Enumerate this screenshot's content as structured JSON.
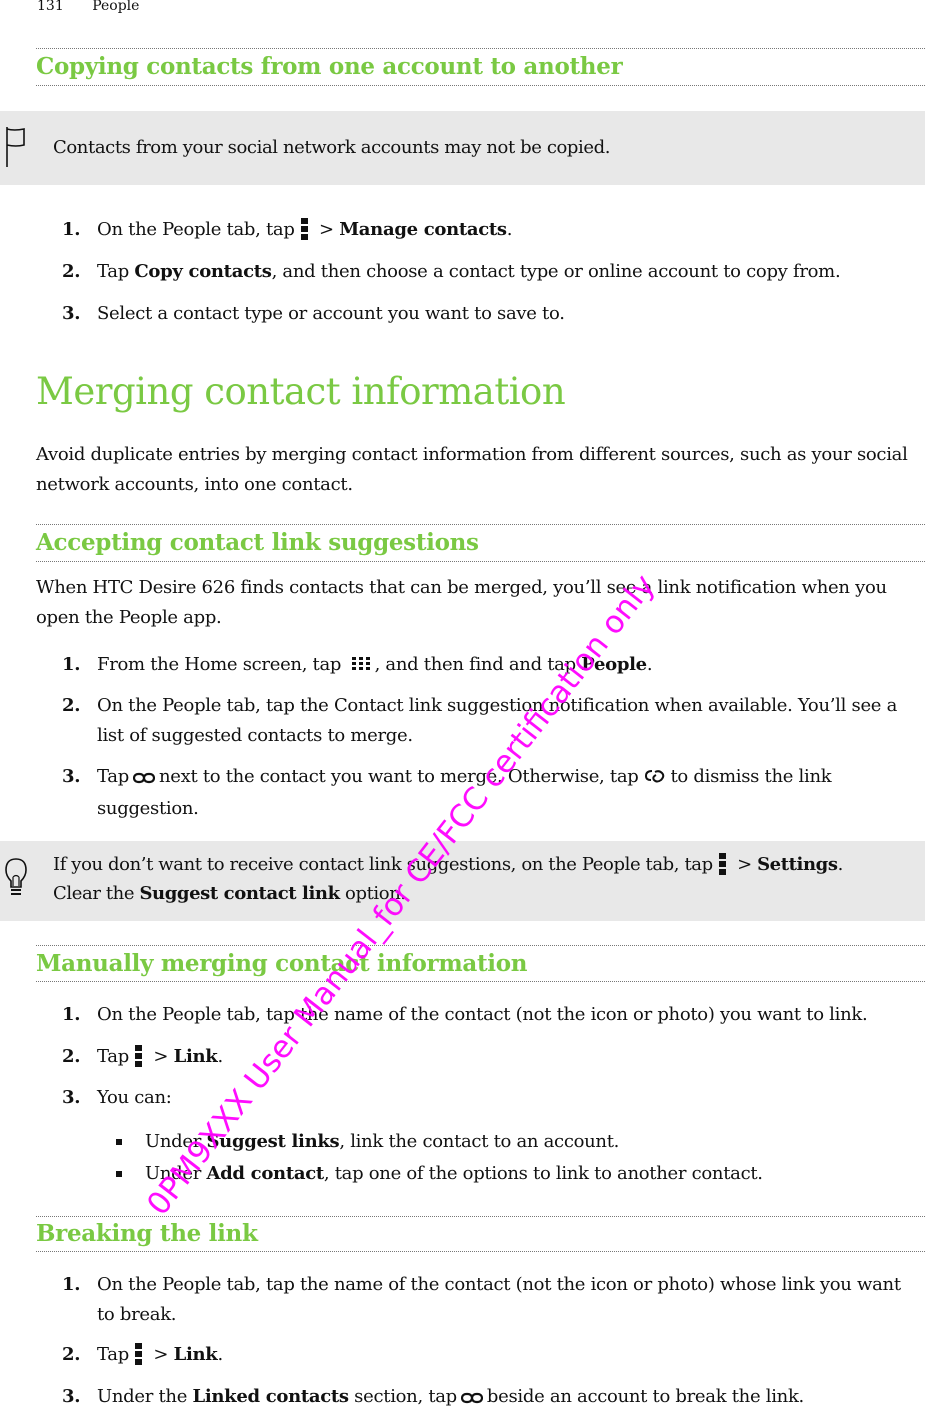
{
  "running_header": {
    "page_number": "131",
    "chapter": "People"
  },
  "sections": {
    "copying": {
      "heading": "Copying contacts from one account to another",
      "note": "Contacts from your social network accounts may not be copied.",
      "steps": [
        {
          "num": "1.",
          "pre": "On the People tab, tap",
          "icon": "menu-icon",
          "mid": " > ",
          "bold": "Manage contacts",
          "post": "."
        },
        {
          "num": "2.",
          "pre": "Tap ",
          "bold": "Copy contacts",
          "post": ", and then choose a contact type or online account to copy from."
        },
        {
          "num": "3.",
          "text": "Select a contact type or account you want to save to."
        }
      ]
    },
    "merging": {
      "heading": "Merging contact information",
      "intro": "Avoid duplicate entries by merging contact information from different sources, such as your social network accounts, into one contact."
    },
    "accepting": {
      "heading": "Accepting contact link suggestions",
      "intro": "When HTC Desire 626 finds contacts that can be merged, you’ll see a link notification when you open the People app.",
      "steps": [
        {
          "num": "1.",
          "pre": "From the Home screen, tap",
          "icon": "apps-grid-icon",
          "mid": ", and then find and tap ",
          "bold": "People",
          "post": "."
        },
        {
          "num": "2.",
          "text": "On the People tab, tap the Contact link suggestion notification when available. You’ll see a list of suggested contacts to merge."
        },
        {
          "num": "3.",
          "pre": "Tap",
          "icon": "link-icon",
          "mid": "next to the contact you want to merge. Otherwise, tap",
          "icon2": "unlink-icon",
          "post": "to dismiss the link suggestion."
        }
      ],
      "tip": {
        "pre": "If you don’t want to receive contact link suggestions, on the People tab, tap",
        "icon": "menu-icon",
        "mid": " > ",
        "bold1": "Settings",
        "mid2": ". Clear the ",
        "bold2": "Suggest contact link",
        "post": " option."
      }
    },
    "manual": {
      "heading": "Manually merging contact information",
      "steps": [
        {
          "num": "1.",
          "text": "On the People tab, tap the name of the contact (not the icon or photo) you want to link."
        },
        {
          "num": "2.",
          "pre": "Tap",
          "icon": "menu-icon",
          "mid": " > ",
          "bold": "Link",
          "post": "."
        },
        {
          "num": "3.",
          "text": "You can:"
        }
      ],
      "bullets": [
        {
          "pre": "Under ",
          "bold": "Suggest links",
          "post": ", link the contact to an account."
        },
        {
          "pre": "Under ",
          "bold": "Add contact",
          "post": ", tap one of the options to link to another contact."
        }
      ]
    },
    "breaking": {
      "heading": "Breaking the link",
      "steps": [
        {
          "num": "1.",
          "text": "On the People tab, tap the name of the contact (not the icon or photo) whose link you want to break."
        },
        {
          "num": "2.",
          "pre": "Tap",
          "icon": "menu-icon",
          "mid": " > ",
          "bold": "Link",
          "post": "."
        },
        {
          "num": "3.",
          "pre": "Under the ",
          "bold": "Linked contacts",
          "mid": " section, tap",
          "icon": "link-icon",
          "post": "beside an account to break the link."
        }
      ]
    }
  },
  "watermark": "0PM9XXX User Manual_for CE/FCC certification only",
  "colors": {
    "heading_green": "#7ac943",
    "note_bg": "#e8e8e8",
    "watermark": "#ff00ff"
  }
}
